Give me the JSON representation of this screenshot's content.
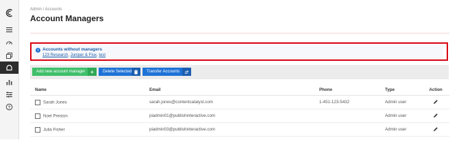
{
  "sidebar": {
    "items": [
      {
        "icon": "logo-icon",
        "active": false
      },
      {
        "icon": "menu-icon",
        "active": false
      },
      {
        "icon": "dashboard-icon",
        "active": false
      },
      {
        "icon": "pages-icon",
        "active": false
      },
      {
        "icon": "accounts-icon",
        "active": true
      },
      {
        "icon": "analytics-icon",
        "active": false
      },
      {
        "icon": "settings-list-icon",
        "active": false
      },
      {
        "icon": "help-icon",
        "active": false
      }
    ]
  },
  "header": {
    "breadcrumb": "Admin / Accounts",
    "title": "Account Managers"
  },
  "alert": {
    "icon": "info-icon",
    "title": "Accounts without managers",
    "links": [
      "123 Research",
      "Juniper & Flux",
      "test"
    ]
  },
  "toolbar": {
    "add_label": "Add new account manager",
    "delete_label": "Delete Selected",
    "transfer_label": "Transfer Accounts"
  },
  "table": {
    "columns": [
      "Name",
      "Email",
      "Phone",
      "Type",
      "Action"
    ],
    "rows": [
      {
        "name": "Sarah Jones",
        "email": "sarah.jones@contentcatalyst.com",
        "phone": "1-451-123-5432",
        "type": "Admin user"
      },
      {
        "name": "Noel Preston",
        "email": "piadmin01@publishinteractive.com",
        "phone": "",
        "type": "Admin user"
      },
      {
        "name": "Julia Fisher",
        "email": "piadmin03@publishinteractive.com",
        "phone": "",
        "type": "Admin user"
      }
    ]
  },
  "colors": {
    "alert_border": "#d7000f",
    "add_button": "#3fbf6a",
    "primary_button": "#1f73d6",
    "link": "#1f5fa8"
  }
}
